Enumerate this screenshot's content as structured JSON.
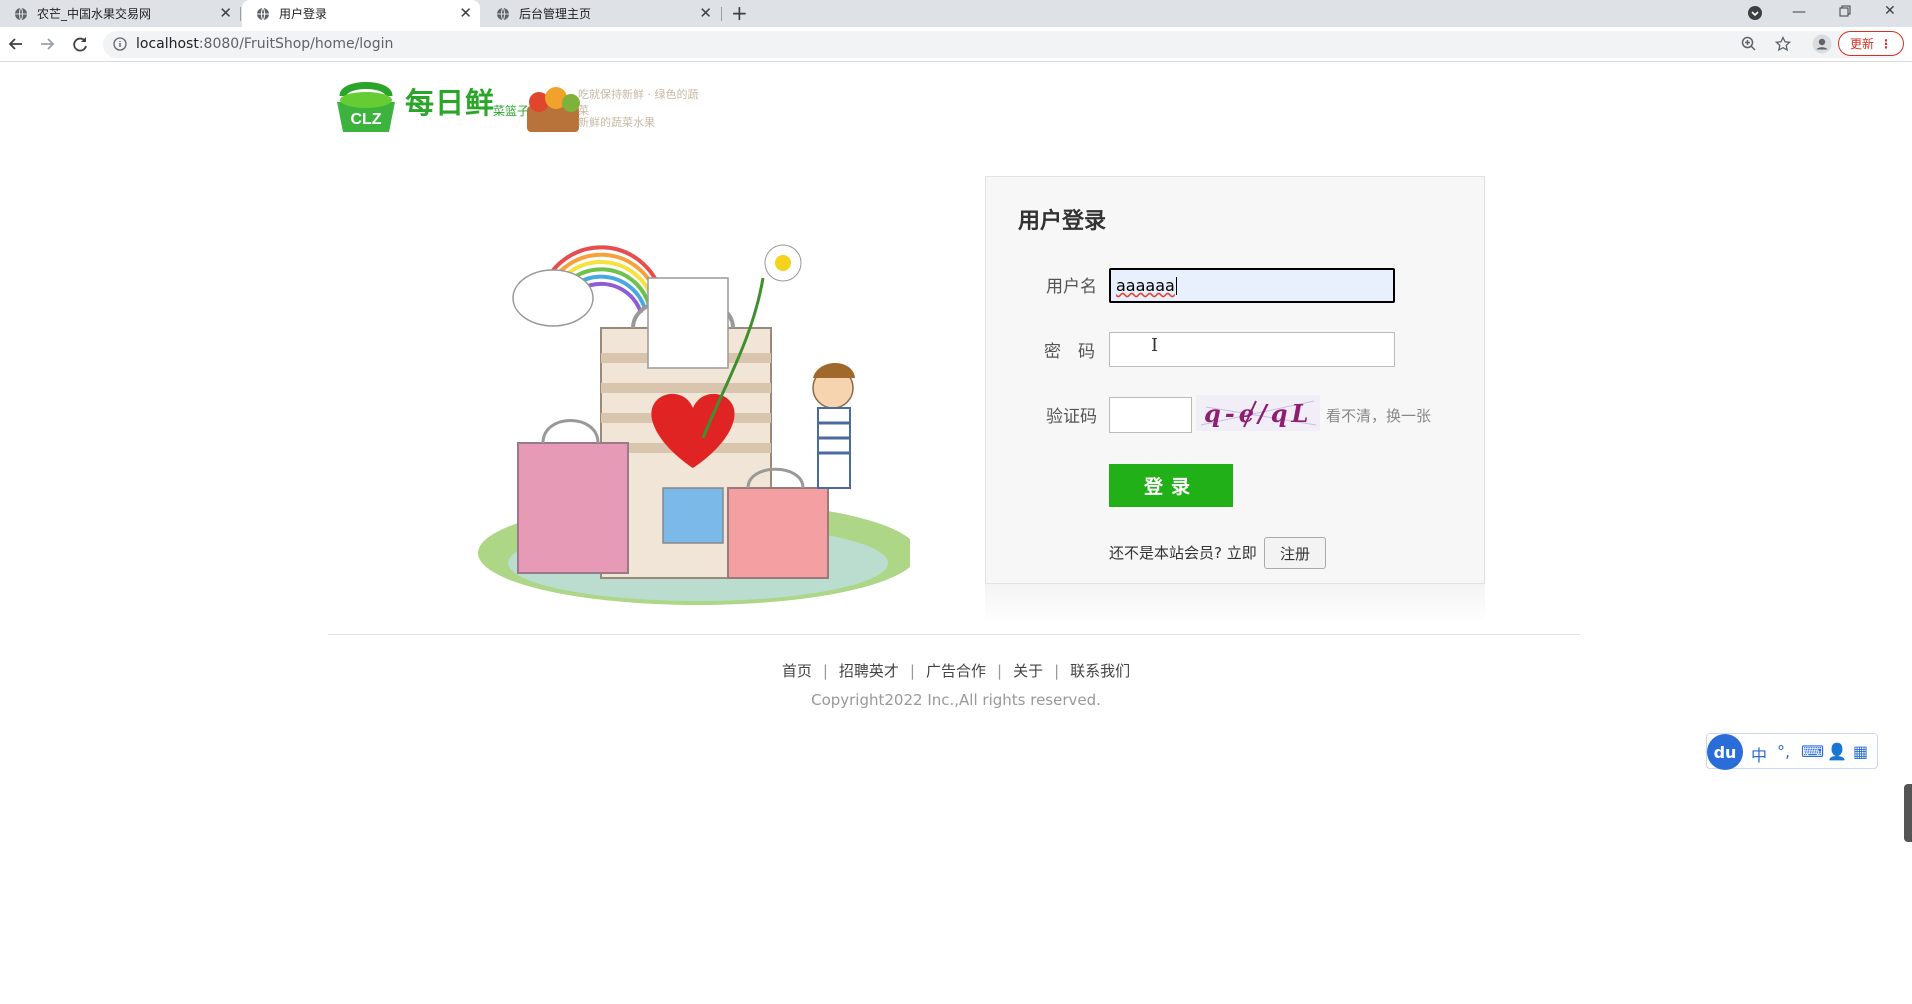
{
  "browser": {
    "tabs": [
      {
        "title": "农芒_中国水果交易网",
        "active": false
      },
      {
        "title": "用户登录",
        "active": true
      },
      {
        "title": "后台管理主页",
        "active": false
      }
    ],
    "new_tab_symbol": "+",
    "url_host": "localhost",
    "url_path": ":8080/FruitShop/home/login",
    "update_label": "更新",
    "icons": [
      "back-icon",
      "forward-icon",
      "reload-icon",
      "info-icon",
      "zoom-icon",
      "star-icon",
      "profile-icon",
      "menu-icon"
    ]
  },
  "logo": {
    "badge": "CLZ",
    "name": "每日鲜",
    "sub": "菜篮子",
    "tag1": "吃就保持新鲜 · 绿色的蔬菜",
    "tag2": "新鲜的蔬菜水果"
  },
  "login": {
    "title": "用户登录",
    "username_label": "用户名",
    "username_value": "aaaaaa",
    "password_label": "密　码",
    "password_value": "",
    "captcha_label": "验证码",
    "captcha_value": "",
    "captcha_text": "q-e/qL",
    "refresh_label": "看不清，换一张",
    "submit_label": "登录",
    "register_prompt": "还不是本站会员? 立即",
    "register_label": "注册"
  },
  "footer": {
    "links": [
      "首页",
      "招聘英才",
      "广告合作",
      "关于",
      "联系我们"
    ],
    "copyright": "Copyright2022 Inc.,All rights reserved."
  },
  "ime": {
    "logo": "du",
    "items": [
      "中",
      "°,",
      "⌨",
      "👤",
      "▦"
    ]
  },
  "colors": {
    "accent_green": "#22b019",
    "logo_green": "#2aa52a",
    "ime_blue": "#2b6dd8"
  }
}
